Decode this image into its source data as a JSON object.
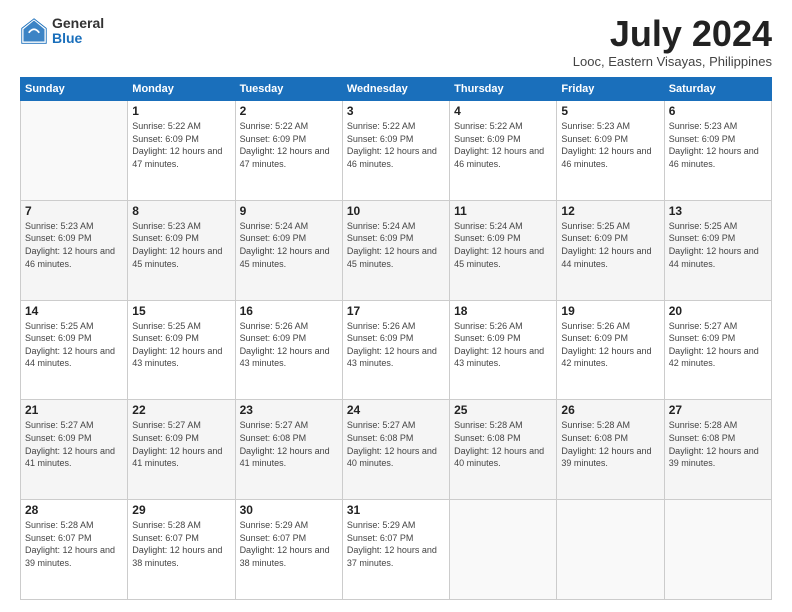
{
  "logo": {
    "general": "General",
    "blue": "Blue"
  },
  "title": {
    "month": "July 2024",
    "location": "Looc, Eastern Visayas, Philippines"
  },
  "weekdays": [
    "Sunday",
    "Monday",
    "Tuesday",
    "Wednesday",
    "Thursday",
    "Friday",
    "Saturday"
  ],
  "weeks": [
    [
      {
        "day": "",
        "sunrise": "",
        "sunset": "",
        "daylight": "",
        "empty": true
      },
      {
        "day": "1",
        "sunrise": "Sunrise: 5:22 AM",
        "sunset": "Sunset: 6:09 PM",
        "daylight": "Daylight: 12 hours and 47 minutes."
      },
      {
        "day": "2",
        "sunrise": "Sunrise: 5:22 AM",
        "sunset": "Sunset: 6:09 PM",
        "daylight": "Daylight: 12 hours and 47 minutes."
      },
      {
        "day": "3",
        "sunrise": "Sunrise: 5:22 AM",
        "sunset": "Sunset: 6:09 PM",
        "daylight": "Daylight: 12 hours and 46 minutes."
      },
      {
        "day": "4",
        "sunrise": "Sunrise: 5:22 AM",
        "sunset": "Sunset: 6:09 PM",
        "daylight": "Daylight: 12 hours and 46 minutes."
      },
      {
        "day": "5",
        "sunrise": "Sunrise: 5:23 AM",
        "sunset": "Sunset: 6:09 PM",
        "daylight": "Daylight: 12 hours and 46 minutes."
      },
      {
        "day": "6",
        "sunrise": "Sunrise: 5:23 AM",
        "sunset": "Sunset: 6:09 PM",
        "daylight": "Daylight: 12 hours and 46 minutes."
      }
    ],
    [
      {
        "day": "7",
        "sunrise": "Sunrise: 5:23 AM",
        "sunset": "Sunset: 6:09 PM",
        "daylight": "Daylight: 12 hours and 46 minutes."
      },
      {
        "day": "8",
        "sunrise": "Sunrise: 5:23 AM",
        "sunset": "Sunset: 6:09 PM",
        "daylight": "Daylight: 12 hours and 45 minutes."
      },
      {
        "day": "9",
        "sunrise": "Sunrise: 5:24 AM",
        "sunset": "Sunset: 6:09 PM",
        "daylight": "Daylight: 12 hours and 45 minutes."
      },
      {
        "day": "10",
        "sunrise": "Sunrise: 5:24 AM",
        "sunset": "Sunset: 6:09 PM",
        "daylight": "Daylight: 12 hours and 45 minutes."
      },
      {
        "day": "11",
        "sunrise": "Sunrise: 5:24 AM",
        "sunset": "Sunset: 6:09 PM",
        "daylight": "Daylight: 12 hours and 45 minutes."
      },
      {
        "day": "12",
        "sunrise": "Sunrise: 5:25 AM",
        "sunset": "Sunset: 6:09 PM",
        "daylight": "Daylight: 12 hours and 44 minutes."
      },
      {
        "day": "13",
        "sunrise": "Sunrise: 5:25 AM",
        "sunset": "Sunset: 6:09 PM",
        "daylight": "Daylight: 12 hours and 44 minutes."
      }
    ],
    [
      {
        "day": "14",
        "sunrise": "Sunrise: 5:25 AM",
        "sunset": "Sunset: 6:09 PM",
        "daylight": "Daylight: 12 hours and 44 minutes."
      },
      {
        "day": "15",
        "sunrise": "Sunrise: 5:25 AM",
        "sunset": "Sunset: 6:09 PM",
        "daylight": "Daylight: 12 hours and 43 minutes."
      },
      {
        "day": "16",
        "sunrise": "Sunrise: 5:26 AM",
        "sunset": "Sunset: 6:09 PM",
        "daylight": "Daylight: 12 hours and 43 minutes."
      },
      {
        "day": "17",
        "sunrise": "Sunrise: 5:26 AM",
        "sunset": "Sunset: 6:09 PM",
        "daylight": "Daylight: 12 hours and 43 minutes."
      },
      {
        "day": "18",
        "sunrise": "Sunrise: 5:26 AM",
        "sunset": "Sunset: 6:09 PM",
        "daylight": "Daylight: 12 hours and 43 minutes."
      },
      {
        "day": "19",
        "sunrise": "Sunrise: 5:26 AM",
        "sunset": "Sunset: 6:09 PM",
        "daylight": "Daylight: 12 hours and 42 minutes."
      },
      {
        "day": "20",
        "sunrise": "Sunrise: 5:27 AM",
        "sunset": "Sunset: 6:09 PM",
        "daylight": "Daylight: 12 hours and 42 minutes."
      }
    ],
    [
      {
        "day": "21",
        "sunrise": "Sunrise: 5:27 AM",
        "sunset": "Sunset: 6:09 PM",
        "daylight": "Daylight: 12 hours and 41 minutes."
      },
      {
        "day": "22",
        "sunrise": "Sunrise: 5:27 AM",
        "sunset": "Sunset: 6:09 PM",
        "daylight": "Daylight: 12 hours and 41 minutes."
      },
      {
        "day": "23",
        "sunrise": "Sunrise: 5:27 AM",
        "sunset": "Sunset: 6:08 PM",
        "daylight": "Daylight: 12 hours and 41 minutes."
      },
      {
        "day": "24",
        "sunrise": "Sunrise: 5:27 AM",
        "sunset": "Sunset: 6:08 PM",
        "daylight": "Daylight: 12 hours and 40 minutes."
      },
      {
        "day": "25",
        "sunrise": "Sunrise: 5:28 AM",
        "sunset": "Sunset: 6:08 PM",
        "daylight": "Daylight: 12 hours and 40 minutes."
      },
      {
        "day": "26",
        "sunrise": "Sunrise: 5:28 AM",
        "sunset": "Sunset: 6:08 PM",
        "daylight": "Daylight: 12 hours and 39 minutes."
      },
      {
        "day": "27",
        "sunrise": "Sunrise: 5:28 AM",
        "sunset": "Sunset: 6:08 PM",
        "daylight": "Daylight: 12 hours and 39 minutes."
      }
    ],
    [
      {
        "day": "28",
        "sunrise": "Sunrise: 5:28 AM",
        "sunset": "Sunset: 6:07 PM",
        "daylight": "Daylight: 12 hours and 39 minutes."
      },
      {
        "day": "29",
        "sunrise": "Sunrise: 5:28 AM",
        "sunset": "Sunset: 6:07 PM",
        "daylight": "Daylight: 12 hours and 38 minutes."
      },
      {
        "day": "30",
        "sunrise": "Sunrise: 5:29 AM",
        "sunset": "Sunset: 6:07 PM",
        "daylight": "Daylight: 12 hours and 38 minutes."
      },
      {
        "day": "31",
        "sunrise": "Sunrise: 5:29 AM",
        "sunset": "Sunset: 6:07 PM",
        "daylight": "Daylight: 12 hours and 37 minutes."
      },
      {
        "day": "",
        "sunrise": "",
        "sunset": "",
        "daylight": "",
        "empty": true
      },
      {
        "day": "",
        "sunrise": "",
        "sunset": "",
        "daylight": "",
        "empty": true
      },
      {
        "day": "",
        "sunrise": "",
        "sunset": "",
        "daylight": "",
        "empty": true
      }
    ]
  ]
}
